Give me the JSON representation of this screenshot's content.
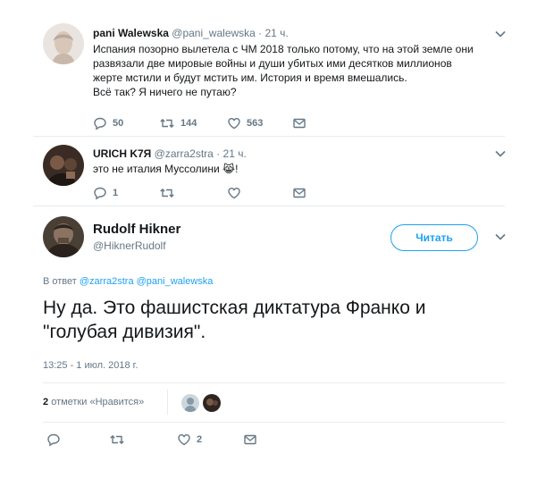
{
  "tweets": [
    {
      "name": "pani Walewska",
      "handle": "@pani_walewska",
      "time": "· 21 ч.",
      "text_lines": [
        "Испания позорно вылетела с ЧМ 2018 только потому, что на этой земле они",
        "развязали две мировые войны и души убитых ими десятков миллионов",
        "жерте мстили и будут мстить им. История и время вмешались.",
        "Всё так? Я ничего не путаю?"
      ],
      "replies": "50",
      "retweets": "144",
      "likes": "563"
    },
    {
      "name": "URICH K7Я",
      "handle": "@zarra2stra",
      "time": "· 21 ч.",
      "text": "это не италия Муссолини 😹!",
      "replies": "1",
      "retweets": "",
      "likes": ""
    }
  ],
  "main": {
    "name": "Rudolf Hikner",
    "handle": "@HiknerRudolf",
    "follow_label": "Читать",
    "reply_prefix": "В ответ",
    "reply_handles": [
      "@zarra2stra",
      "@pani_walewska"
    ],
    "text_line1": "Ну да. Это фашистская диктатура Франко и",
    "text_line2": "\"голубая дивизия\".",
    "timestamp": "13:25 - 1 июл. 2018 г.",
    "likes_count": "2",
    "likes_label": "отметки «Нравится»",
    "action_likes": "2"
  },
  "colors": {
    "accent": "#1da1f2",
    "muted": "#657786",
    "text": "#14171a",
    "divider": "#e6ecf0"
  },
  "icons": [
    "reply-icon",
    "retweet-icon",
    "heart-icon",
    "message-icon",
    "chevron-down-icon"
  ]
}
